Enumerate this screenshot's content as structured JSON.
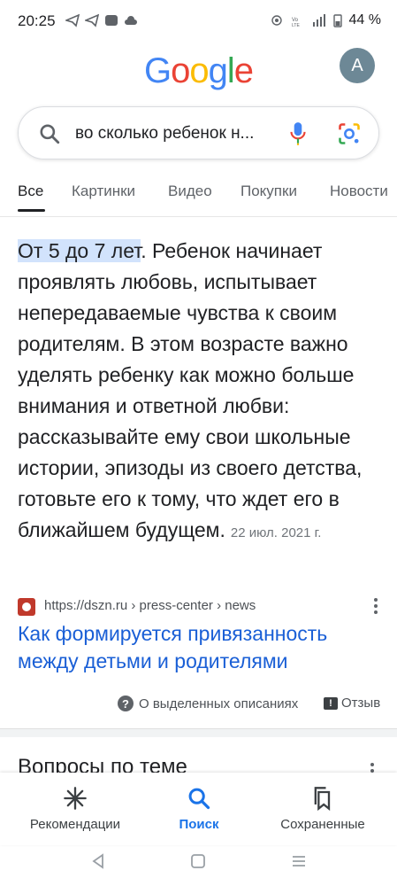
{
  "status_bar": {
    "time": "20:25",
    "battery": "44 %",
    "icons": [
      "telegram-icon",
      "telegram-icon",
      "app-icon",
      "cloud-icon",
      "hotspot-icon",
      "volte-icon",
      "signal-icon",
      "battery-icon"
    ]
  },
  "header": {
    "logo": [
      "G",
      "o",
      "o",
      "g",
      "l",
      "e"
    ],
    "logo_colors": [
      "#4285F4",
      "#EA4335",
      "#FBBC05",
      "#4285F4",
      "#34A853",
      "#EA4335"
    ],
    "avatar_letter": "A"
  },
  "search": {
    "query": "во сколько ребенок н..."
  },
  "tabs": [
    {
      "label": "Все",
      "active": true
    },
    {
      "label": "Картинки",
      "active": false
    },
    {
      "label": "Видео",
      "active": false
    },
    {
      "label": "Покупки",
      "active": false
    },
    {
      "label": "Новости",
      "active": false
    }
  ],
  "featured_snippet": {
    "highlight": "От 5 до 7 лет",
    "text": ". Ребенок начинает проявлять любовь, испытывает непередаваемые чувства к своим родителям. В этом возрасте важно уделять ребенку как можно больше внимания и ответной любви: рассказывайте ему свои школьные истории, эпизоды из своего детства, готовьте его к тому, что ждет его в ближайшем будущем.",
    "date": "22 июл. 2021 г."
  },
  "result": {
    "url": "https://dszn.ru › press-center › news",
    "title": "Как формируется привязанность между детьми и родителями"
  },
  "feedback": {
    "about": "О выделенных описаниях",
    "feedback": "Отзыв"
  },
  "related": {
    "title": "Вопросы по теме"
  },
  "bottom_nav": [
    {
      "label": "Рекомендации",
      "icon": "discover-icon",
      "active": false
    },
    {
      "label": "Поиск",
      "icon": "search-icon",
      "active": true
    },
    {
      "label": "Сохраненные",
      "icon": "bookmarks-icon",
      "active": false
    }
  ],
  "colors": {
    "accent": "#1a73e8",
    "link": "#1a5fd6",
    "highlight": "#d2e3fc"
  }
}
